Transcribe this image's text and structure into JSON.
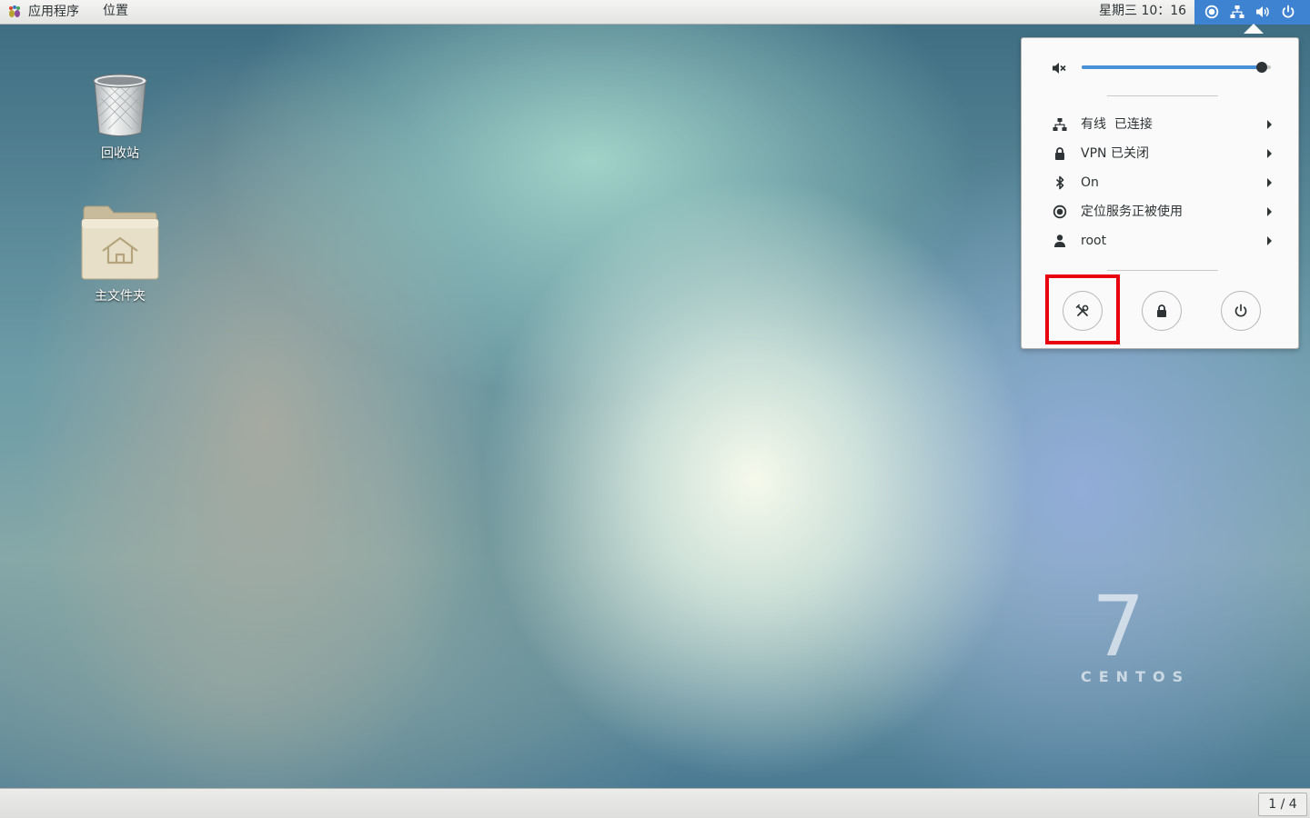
{
  "topbar": {
    "applications_label": "应用程序",
    "places_label": "位置",
    "clock": "星期三 10：16",
    "status_icons": [
      "location-icon",
      "network-wired-icon",
      "volume-icon",
      "power-icon"
    ],
    "status_area_color": "#3e82d2"
  },
  "desktop": {
    "icons": [
      {
        "label": "回收站",
        "icon": "trash-icon"
      },
      {
        "label": "主文件夹",
        "icon": "home-folder-icon"
      }
    ],
    "watermark_number": "7",
    "watermark_text": "CENTOS"
  },
  "system_menu": {
    "volume": {
      "icon": "volume-muted-icon",
      "level": 0.95
    },
    "items": [
      {
        "label": "有线  已连接",
        "icon": "network-wired-icon"
      },
      {
        "label": "VPN 已关闭",
        "icon": "vpn-lock-icon"
      },
      {
        "label": "On",
        "icon": "bluetooth-icon"
      },
      {
        "label": "定位服务正被使用",
        "icon": "location-icon"
      },
      {
        "label": "root",
        "icon": "user-icon"
      }
    ],
    "actions": [
      {
        "name": "settings",
        "icon": "settings-tools-icon",
        "highlighted": true
      },
      {
        "name": "lock",
        "icon": "lock-icon",
        "highlighted": false
      },
      {
        "name": "power",
        "icon": "power-icon",
        "highlighted": false
      }
    ],
    "highlight_color": "#e8000e",
    "accent_color": "#4a90d9"
  },
  "bottombar": {
    "workspace_indicator": "1 / 4"
  }
}
